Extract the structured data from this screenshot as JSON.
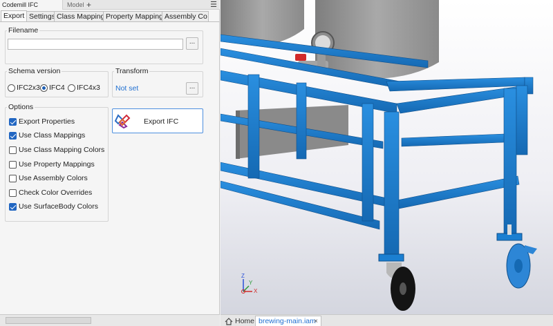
{
  "panel": {
    "title": "Codemill IFC Exporter",
    "model_tab": "Model",
    "add": "+",
    "menu": "☰"
  },
  "tabs": [
    "Export",
    "Settings",
    "Class Mappings",
    "Property Mappings",
    "Assembly Co"
  ],
  "filename": {
    "legend": "Filename",
    "value": "",
    "browse": "..."
  },
  "schema": {
    "legend": "Schema version",
    "options": [
      "IFC2x3",
      "IFC4",
      "IFC4x3"
    ],
    "selected": "IFC4"
  },
  "transform": {
    "legend": "Transform",
    "value": "Not set",
    "browse": "..."
  },
  "options": {
    "legend": "Options",
    "items": [
      {
        "label": "Export Properties",
        "checked": true
      },
      {
        "label": "Use Class Mappings",
        "checked": true
      },
      {
        "label": "Use Class Mapping Colors",
        "checked": false
      },
      {
        "label": "Use Property Mappings",
        "checked": false
      },
      {
        "label": "Use Assembly Colors",
        "checked": false
      },
      {
        "label": "Check Color Overrides",
        "checked": false
      },
      {
        "label": "Use SurfaceBody Colors",
        "checked": true
      }
    ]
  },
  "export_button": "Export IFC",
  "doc_tabs": {
    "home": "Home",
    "file": "brewing-main.iam",
    "close": "×"
  },
  "axes": {
    "x": "X",
    "y": "Y",
    "z": "Z"
  },
  "colors": {
    "frame_blue": "#1b7fd1",
    "tank_gray": "#9a9a9a",
    "accent": "#1f6fd1"
  }
}
